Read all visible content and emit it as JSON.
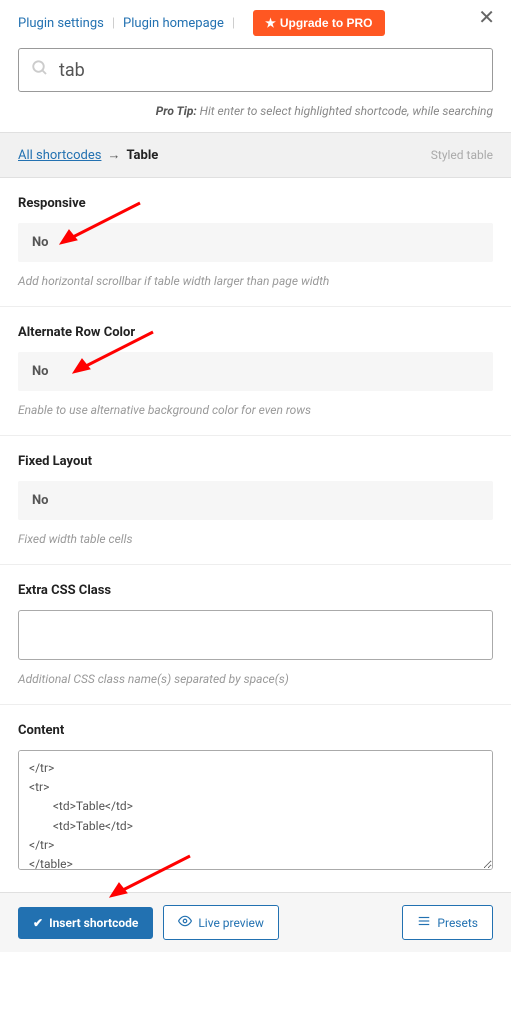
{
  "header": {
    "plugin_settings": "Plugin settings",
    "plugin_homepage": "Plugin homepage",
    "upgrade_label": "Upgrade to PRO"
  },
  "search": {
    "value": "tab"
  },
  "pro_tip": {
    "label": "Pro Tip:",
    "text": "Hit enter to select highlighted shortcode, while searching"
  },
  "breadcrumb": {
    "all": "All shortcodes",
    "arrow": "→",
    "current": "Table",
    "right": "Styled table"
  },
  "fields": {
    "responsive": {
      "label": "Responsive",
      "value": "No",
      "help": "Add horizontal scrollbar if table width larger than page width"
    },
    "alternate": {
      "label": "Alternate Row Color",
      "value": "No",
      "help": "Enable to use alternative background color for even rows"
    },
    "fixed": {
      "label": "Fixed Layout",
      "value": "No",
      "help": "Fixed width table cells"
    },
    "css": {
      "label": "Extra CSS Class",
      "value": "",
      "help": "Additional CSS class name(s) separated by space(s)"
    },
    "content": {
      "label": "Content",
      "value": "</tr>\n<tr>\n        <td>Table</td>\n        <td>Table</td>\n</tr>\n</table>"
    }
  },
  "footer": {
    "insert": "Insert shortcode",
    "preview": "Live preview",
    "presets": "Presets"
  }
}
